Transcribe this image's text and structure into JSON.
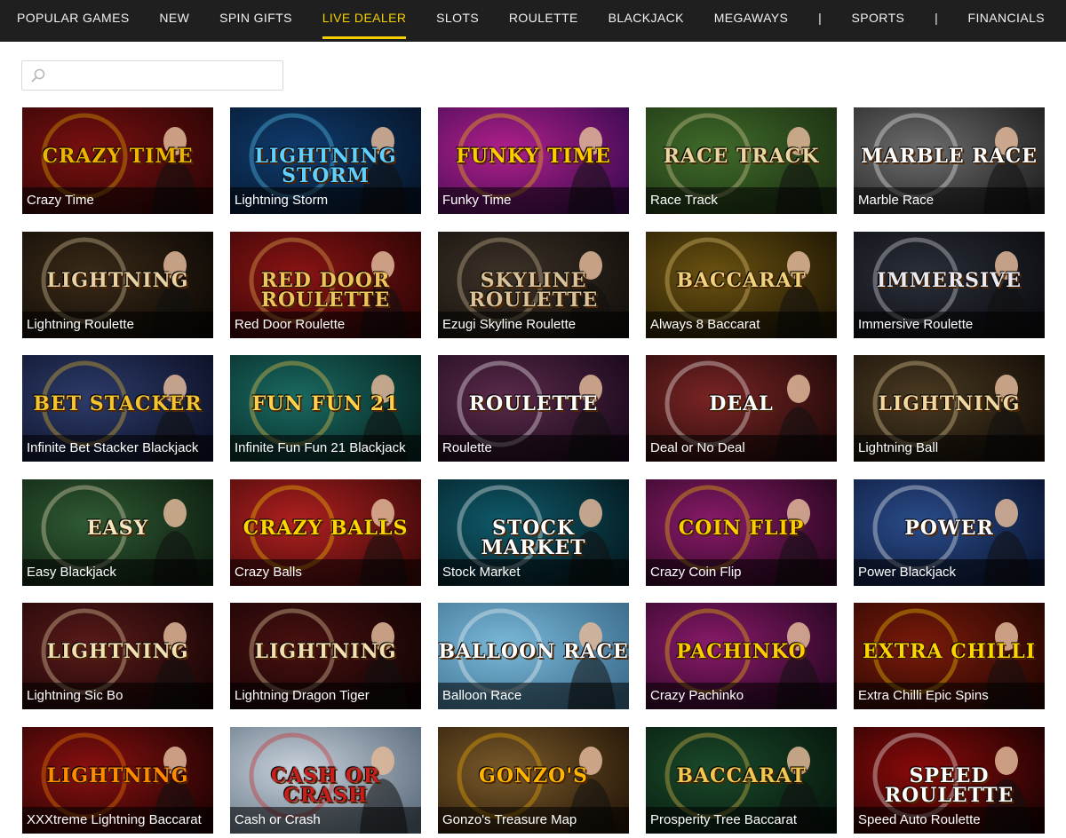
{
  "nav": {
    "items": [
      {
        "label": "POPULAR GAMES",
        "active": false
      },
      {
        "label": "NEW",
        "active": false
      },
      {
        "label": "SPIN GIFTS",
        "active": false
      },
      {
        "label": "LIVE DEALER",
        "active": true
      },
      {
        "label": "SLOTS",
        "active": false
      },
      {
        "label": "ROULETTE",
        "active": false
      },
      {
        "label": "BLACKJACK",
        "active": false
      },
      {
        "label": "MEGAWAYS",
        "active": false
      },
      {
        "label": "SPORTS",
        "active": false
      },
      {
        "label": "FINANCIALS",
        "active": false
      }
    ],
    "separator": "|",
    "accent_color": "#f5d000",
    "background": "#1f1f1f"
  },
  "search": {
    "value": "",
    "placeholder": "",
    "icon": "search-icon"
  },
  "games": [
    {
      "title": "Crazy Time",
      "logo": "Crazy Time",
      "bg1": "#7a1010",
      "bg2": "#2a0505",
      "accent": "#f0b400"
    },
    {
      "title": "Lightning Storm",
      "logo": "Lightning Storm",
      "bg1": "#0f3c6e",
      "bg2": "#061428",
      "accent": "#5fd0ff"
    },
    {
      "title": "Funky Time",
      "logo": "Funky Time",
      "bg1": "#b0208a",
      "bg2": "#3a0a50",
      "accent": "#ffcc00"
    },
    {
      "title": "Race Track",
      "logo": "Race Track",
      "bg1": "#3f6b2a",
      "bg2": "#1c2f12",
      "accent": "#e8d7a0"
    },
    {
      "title": "Marble Race",
      "logo": "Marble Race",
      "bg1": "#6d6d6d",
      "bg2": "#1e1e1e",
      "accent": "#ffffff"
    },
    {
      "title": "Lightning Roulette",
      "logo": "Lightning",
      "bg1": "#3a2a18",
      "bg2": "#0c0804",
      "accent": "#e6d2a2"
    },
    {
      "title": "Red Door Roulette",
      "logo": "Red Door Roulette",
      "bg1": "#8a1414",
      "bg2": "#2c0404",
      "accent": "#f2c35a"
    },
    {
      "title": "Ezugi Skyline Roulette",
      "logo": "Skyline Roulette",
      "bg1": "#3c3228",
      "bg2": "#120e0a",
      "accent": "#d8c39a"
    },
    {
      "title": "Always 8 Baccarat",
      "logo": "Baccarat",
      "bg1": "#6a5210",
      "bg2": "#1e1604",
      "accent": "#f1d27a"
    },
    {
      "title": "Immersive Roulette",
      "logo": "Immersive",
      "bg1": "#2a2e38",
      "bg2": "#0b0c10",
      "accent": "#e9e9f2"
    },
    {
      "title": "Infinite Bet Stacker Blackjack",
      "logo": "Bet Stacker",
      "bg1": "#2d3b6a",
      "bg2": "#0b1024",
      "accent": "#f4c430"
    },
    {
      "title": "Infinite Fun Fun 21 Blackjack",
      "logo": "Fun Fun 21",
      "bg1": "#1a6a62",
      "bg2": "#06221f",
      "accent": "#ffd24a"
    },
    {
      "title": "Roulette",
      "logo": "Roulette",
      "bg1": "#5a2a4a",
      "bg2": "#18081a",
      "accent": "#ffffff"
    },
    {
      "title": "Deal or No Deal",
      "logo": "Deal",
      "bg1": "#7a2424",
      "bg2": "#1c0808",
      "accent": "#ffffff"
    },
    {
      "title": "Lightning Ball",
      "logo": "Lightning",
      "bg1": "#4a3a22",
      "bg2": "#120c06",
      "accent": "#f0d8a0"
    },
    {
      "title": "Easy Blackjack",
      "logo": "Easy",
      "bg1": "#2f5a34",
      "bg2": "#0c1c0e",
      "accent": "#f5e8c0"
    },
    {
      "title": "Crazy Balls",
      "logo": "Crazy Balls",
      "bg1": "#b02020",
      "bg2": "#3a0808",
      "accent": "#ffd400"
    },
    {
      "title": "Stock Market",
      "logo": "Stock Market",
      "bg1": "#0f5a6a",
      "bg2": "#04181e",
      "accent": "#ffffff"
    },
    {
      "title": "Crazy Coin Flip",
      "logo": "Coin Flip",
      "bg1": "#8a1a6a",
      "bg2": "#24061c",
      "accent": "#ffcc00"
    },
    {
      "title": "Power Blackjack",
      "logo": "Power",
      "bg1": "#2a4c8a",
      "bg2": "#0a1430",
      "accent": "#ffffff"
    },
    {
      "title": "Lightning Sic Bo",
      "logo": "Lightning",
      "bg1": "#5a1a1a",
      "bg2": "#160404",
      "accent": "#f3e0b0"
    },
    {
      "title": "Lightning Dragon Tiger",
      "logo": "Lightning",
      "bg1": "#4a1010",
      "bg2": "#100303",
      "accent": "#f3e0b0"
    },
    {
      "title": "Balloon Race",
      "logo": "Balloon Race",
      "bg1": "#7ab8d8",
      "bg2": "#3a6a8a",
      "accent": "#ffffff"
    },
    {
      "title": "Crazy Pachinko",
      "logo": "Pachinko",
      "bg1": "#8a1a6a",
      "bg2": "#240620",
      "accent": "#ffcc00"
    },
    {
      "title": "Extra Chilli Epic Spins",
      "logo": "Extra Chilli",
      "bg1": "#7a1a0a",
      "bg2": "#220602",
      "accent": "#ffd400"
    },
    {
      "title": "XXXtreme Lightning Baccarat",
      "logo": "Lightning",
      "bg1": "#8a1010",
      "bg2": "#1c0202",
      "accent": "#ff8a00"
    },
    {
      "title": "Cash or Crash",
      "logo": "Cash or Crash",
      "bg1": "#c8d2dc",
      "bg2": "#5a6a7a",
      "accent": "#c81e1e"
    },
    {
      "title": "Gonzo's Treasure Map",
      "logo": "Gonzo's",
      "bg1": "#7a5a2a",
      "bg2": "#241608",
      "accent": "#ffb400"
    },
    {
      "title": "Prosperity Tree Baccarat",
      "logo": "Baccarat",
      "bg1": "#1a4a2a",
      "bg2": "#06160c",
      "accent": "#f0c850"
    },
    {
      "title": "Speed Auto Roulette",
      "logo": "Speed Roulette",
      "bg1": "#8a0a0a",
      "bg2": "#1a0202",
      "accent": "#ffffff"
    }
  ]
}
